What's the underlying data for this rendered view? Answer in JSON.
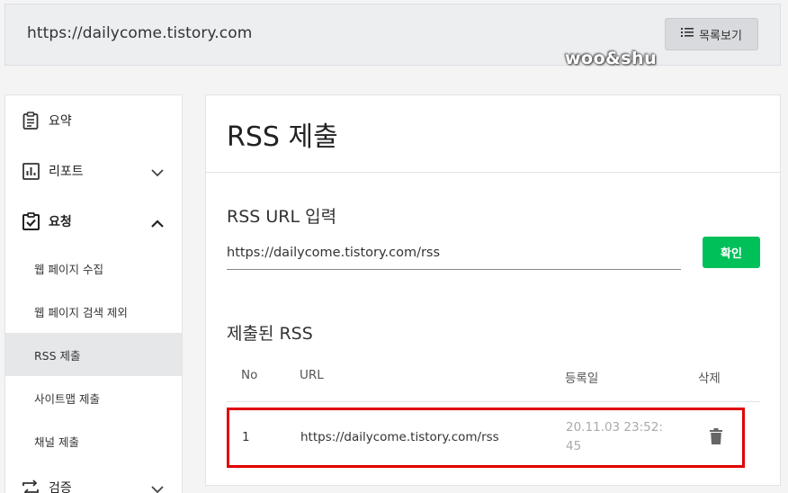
{
  "header": {
    "site_url": "https://dailycome.tistory.com",
    "list_button_label": "목록보기",
    "list_icon": "list-icon",
    "watermark": "woo&shu"
  },
  "sidebar": {
    "items": [
      {
        "label": "요약",
        "icon": "clipboard-icon"
      },
      {
        "label": "리포트",
        "icon": "chart-icon",
        "expanded": false
      },
      {
        "label": "요청",
        "icon": "checklist-icon",
        "expanded": true
      },
      {
        "label": "검증",
        "icon": "repeat-icon",
        "expanded": false
      }
    ],
    "sub_items": [
      {
        "label": "웹 페이지 수집",
        "active": false
      },
      {
        "label": "웹 페이지 검색 제외",
        "active": false
      },
      {
        "label": "RSS 제출",
        "active": true
      },
      {
        "label": "사이트맵 제출",
        "active": false
      },
      {
        "label": "채널 제출",
        "active": false
      }
    ]
  },
  "main": {
    "title": "RSS 제출",
    "input_section_label": "RSS URL 입력",
    "rss_url_value": "https://dailycome.tistory.com/rss",
    "confirm_label": "확인",
    "submitted_section_label": "제출된 RSS",
    "table": {
      "columns": [
        "No",
        "URL",
        "등록일",
        "삭제"
      ],
      "rows": [
        {
          "no": "1",
          "url": "https://dailycome.tistory.com/rss",
          "date_line1": "20.11.03 23:52:",
          "date_line2": "45",
          "delete_icon": "trash-icon"
        }
      ]
    }
  },
  "colors": {
    "accent_green": "#00c05a",
    "highlight_red": "#e00000",
    "active_bg": "#e6e7e9"
  }
}
